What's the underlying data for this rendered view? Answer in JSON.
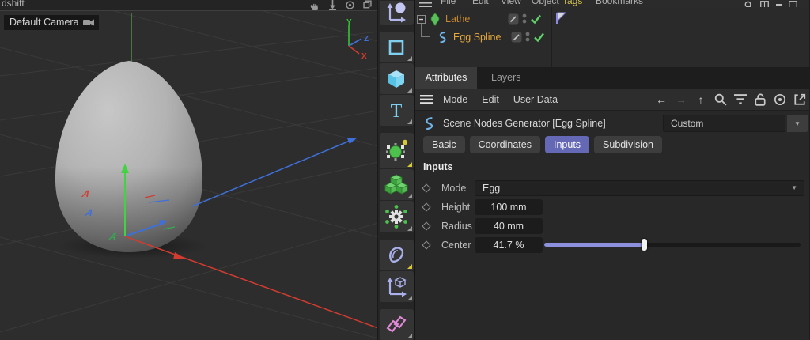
{
  "window": {
    "menu_tail": "dshift"
  },
  "viewport": {
    "camera_label": "Default Camera",
    "axis_widget": {
      "x": "X",
      "y": "Y",
      "z": "Z"
    }
  },
  "top_menu": {
    "items": [
      "File",
      "Edit",
      "View",
      "Object",
      "Tags",
      "Bookmarks"
    ]
  },
  "object_manager": {
    "rows": [
      {
        "name": "Lathe"
      },
      {
        "name": "Egg Spline"
      }
    ]
  },
  "attributes_panel": {
    "tabs": {
      "attributes": "Attributes",
      "layers": "Layers"
    },
    "menu_items": {
      "mode": "Mode",
      "edit": "Edit",
      "user_data": "User Data"
    },
    "object_title": "Scene Nodes Generator [Egg Spline]",
    "preset_value": "Custom",
    "section_tabs": {
      "basic": "Basic",
      "coordinates": "Coordinates",
      "inputs": "Inputs",
      "subdivision": "Subdivision"
    },
    "active_section_tab": "Inputs",
    "group_heading": "Inputs",
    "params": {
      "mode": {
        "label": "Mode",
        "value": "Egg"
      },
      "height": {
        "label": "Height",
        "value": "100 mm"
      },
      "radius": {
        "label": "Radius",
        "value": "40 mm"
      },
      "center": {
        "label": "Center",
        "value": "41.7 %",
        "slider_percent": 39
      }
    }
  },
  "colors": {
    "accent_purple": "#6568b4",
    "slider_purple": "#8d91dd",
    "lathe_orange": "#c9872f",
    "spline_orange": "#e5a93c",
    "check_green": "#5fd36a",
    "icon_blue": "#7fd0f0",
    "icon_green": "#55bb55",
    "icon_periwinkle": "#aab0ea",
    "icon_pink": "#e08ad8"
  }
}
